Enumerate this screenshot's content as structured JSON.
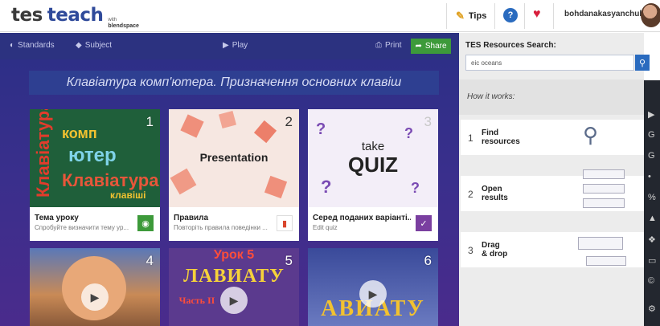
{
  "header": {
    "logo_tes": "tes",
    "logo_teach": "teach",
    "logo_with": "with",
    "logo_blendspace": "blendspace",
    "tips_label": "Tips",
    "help_label": "?",
    "username": "bohdanakasyanchuk",
    "colors": {
      "brand_blue": "#2f4a9a",
      "heart": "#d81f3c"
    }
  },
  "toolbar": {
    "standards": "Standards",
    "subject": "Subject",
    "play": "Play",
    "print": "Print",
    "share": "Share"
  },
  "lesson": {
    "title": "Клавіатура комп'ютера. Призначення основних клавіш"
  },
  "cards": [
    {
      "number": "1",
      "title": "Тема уроку",
      "subtitle": "Спробуйте визначити тему ур...",
      "action_icon": "camera-icon",
      "thumb_words": [
        "Клавіатура",
        "комп",
        "ютер",
        "клавіші"
      ]
    },
    {
      "number": "2",
      "title": "Правила",
      "subtitle": "Повторіть правила поведінки ...",
      "action_icon": "document-icon",
      "thumb_text": "Presentation"
    },
    {
      "number": "3",
      "title": "Серед поданих варіанті...",
      "subtitle": "Edit quiz",
      "action_icon": "check-icon",
      "thumb_text_1": "take",
      "thumb_text_2": "QUIZ"
    },
    {
      "number": "4",
      "title": "",
      "subtitle": "",
      "action_icon": "play-icon"
    },
    {
      "number": "5",
      "title": "",
      "subtitle": "",
      "action_icon": "play-icon",
      "thumb_text_1": "Урок 5",
      "thumb_text_2": "ЛАВИАТУ",
      "thumb_text_3": "Часть II"
    },
    {
      "number": "6",
      "title": "",
      "subtitle": "",
      "action_icon": "play-icon",
      "thumb_text": "АВИАТУ"
    }
  ],
  "sidebar": {
    "search_title": "TES Resources Search:",
    "search_value": "eic oceans",
    "how_label": "How it works:",
    "steps": [
      {
        "n": "1",
        "label": "Find\nresources"
      },
      {
        "n": "2",
        "label": "Open\nresults"
      },
      {
        "n": "3",
        "label": "Drag\n& drop"
      }
    ],
    "mini_logo": "tes"
  }
}
